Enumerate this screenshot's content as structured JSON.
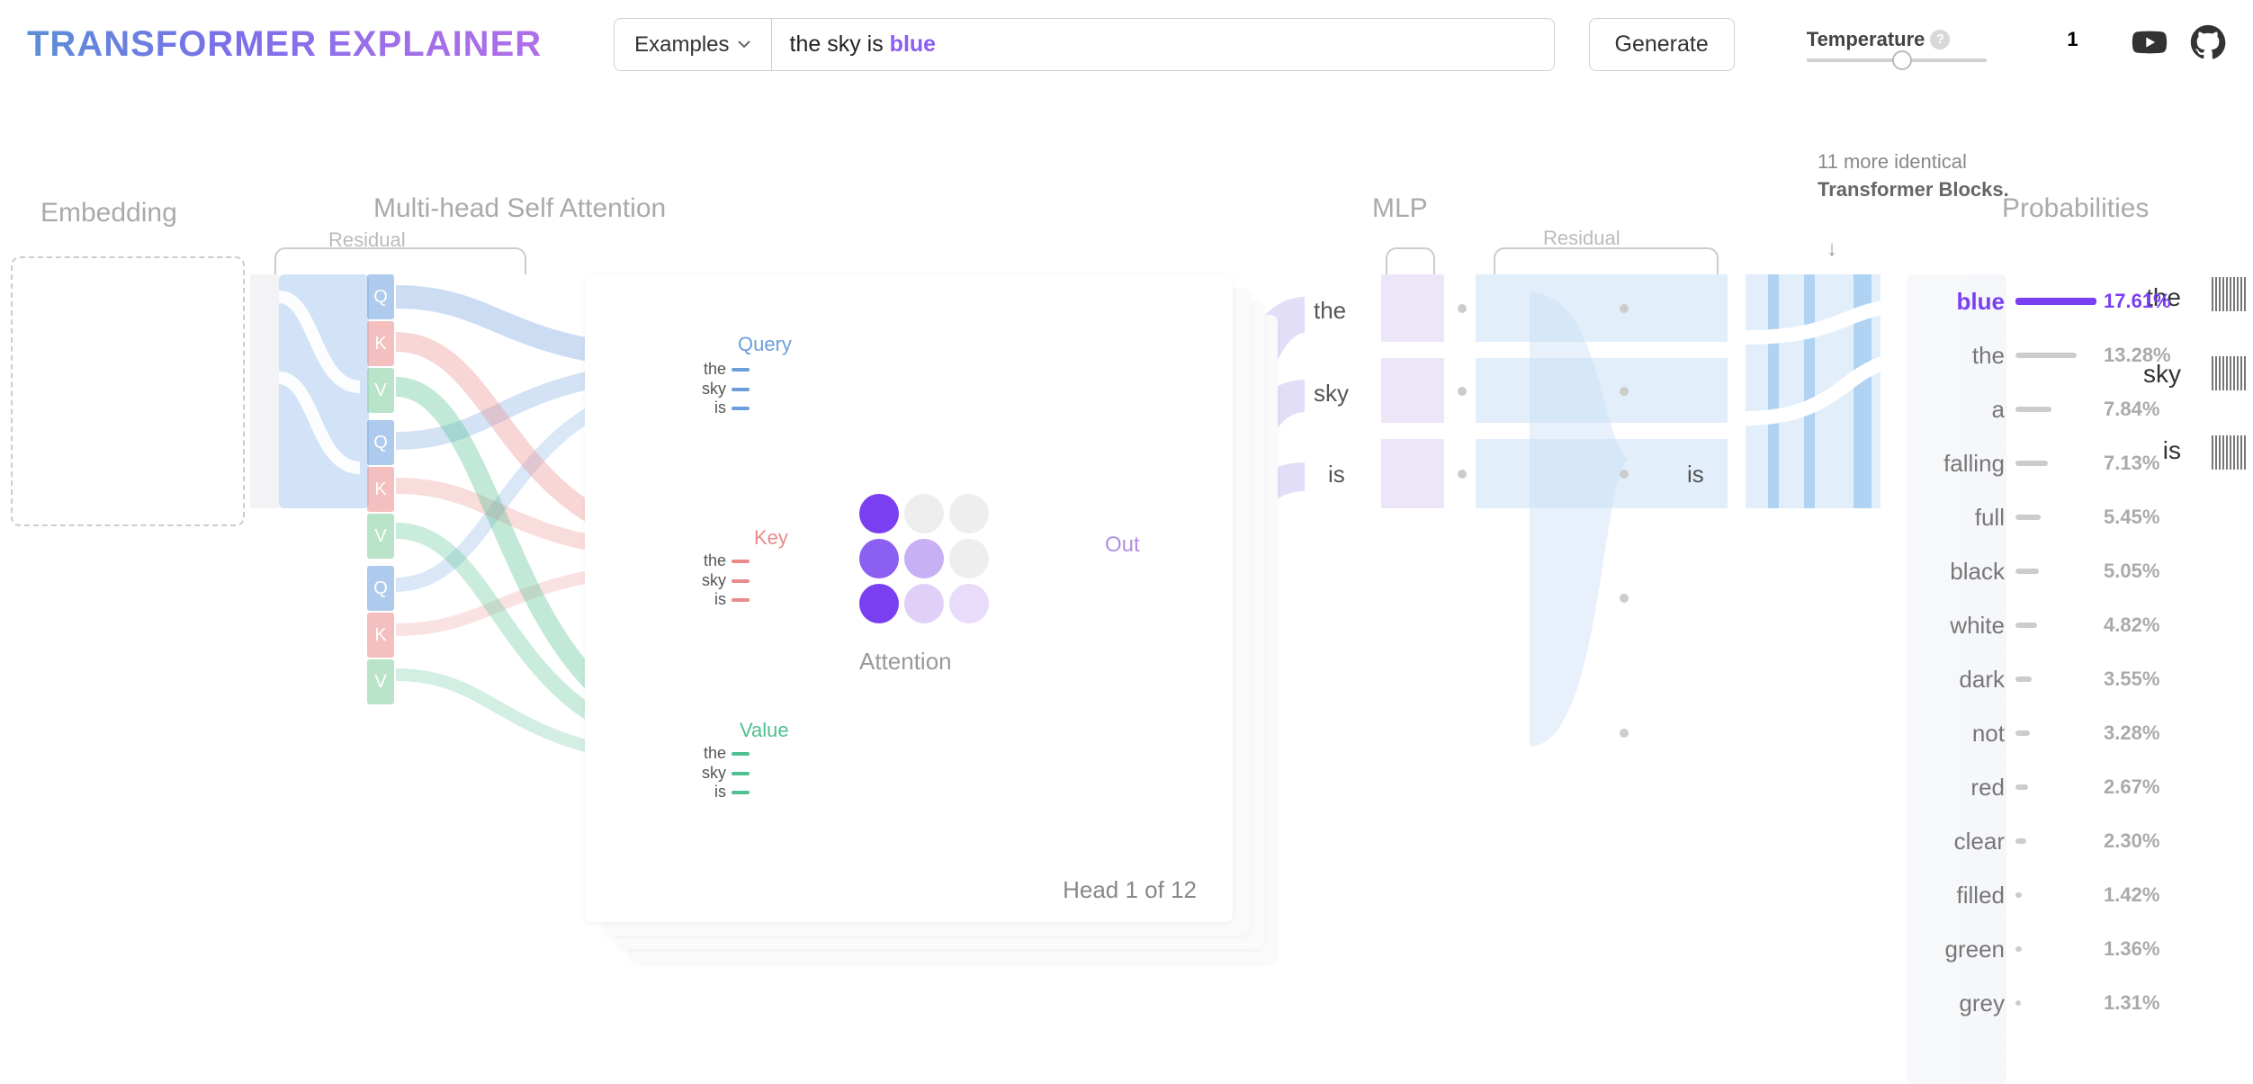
{
  "header": {
    "logo": "Transformer Explainer",
    "examples_label": "Examples",
    "input_prefix": "the sky is ",
    "input_prediction": "blue",
    "generate_label": "Generate",
    "temperature_label": "Temperature",
    "temperature_value": "1"
  },
  "sections": {
    "embedding": "Embedding",
    "attention": "Multi-head Self Attention",
    "residual_1": "Residual",
    "mlp": "MLP",
    "residual_2": "Residual",
    "probabilities": "Probabilities",
    "blocks_note_prefix": "11 more identical ",
    "blocks_note_bold": "Transformer Blocks.",
    "attention_title": "Attention",
    "out_label": "Out",
    "head_label": "Head 1 of 12"
  },
  "tokens": [
    "the",
    "sky",
    "is"
  ],
  "qkv": {
    "q": "Q",
    "k": "K",
    "v": "V",
    "query": "Query",
    "key": "Key",
    "value": "Value"
  },
  "probabilities": [
    {
      "word": "blue",
      "pct": "17.61%",
      "bar": 90,
      "top": true
    },
    {
      "word": "the",
      "pct": "13.28%",
      "bar": 68
    },
    {
      "word": "a",
      "pct": "7.84%",
      "bar": 40
    },
    {
      "word": "falling",
      "pct": "7.13%",
      "bar": 36
    },
    {
      "word": "full",
      "pct": "5.45%",
      "bar": 28
    },
    {
      "word": "black",
      "pct": "5.05%",
      "bar": 26
    },
    {
      "word": "white",
      "pct": "4.82%",
      "bar": 24
    },
    {
      "word": "dark",
      "pct": "3.55%",
      "bar": 18
    },
    {
      "word": "not",
      "pct": "3.28%",
      "bar": 16
    },
    {
      "word": "red",
      "pct": "2.67%",
      "bar": 14
    },
    {
      "word": "clear",
      "pct": "2.30%",
      "bar": 12
    },
    {
      "word": "filled",
      "pct": "1.42%",
      "bar": 7
    },
    {
      "word": "green",
      "pct": "1.36%",
      "bar": 7
    },
    {
      "word": "grey",
      "pct": "1.31%",
      "bar": 6
    }
  ],
  "colors": {
    "accent": "#7B3FF2",
    "query": "#6c9edc",
    "key": "#eb8a8a",
    "value": "#50c090"
  }
}
